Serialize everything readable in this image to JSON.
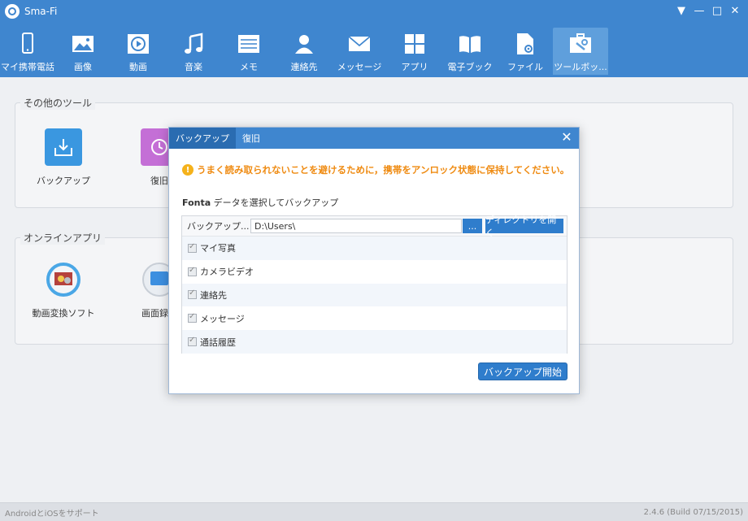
{
  "app": {
    "title": "Sma-Fi"
  },
  "window_controls": {
    "menu": "▼",
    "minimize": "—",
    "maximize": "□",
    "close": "✕"
  },
  "toolbar": {
    "items": [
      {
        "label": "マイ携帯電話",
        "icon": "phone-icon"
      },
      {
        "label": "画像",
        "icon": "image-icon"
      },
      {
        "label": "動画",
        "icon": "video-icon"
      },
      {
        "label": "音楽",
        "icon": "music-icon"
      },
      {
        "label": "メモ",
        "icon": "memo-icon"
      },
      {
        "label": "連絡先",
        "icon": "contacts-icon"
      },
      {
        "label": "メッセージ",
        "icon": "message-icon"
      },
      {
        "label": "アプリ",
        "icon": "apps-icon"
      },
      {
        "label": "電子ブック",
        "icon": "ebook-icon"
      },
      {
        "label": "ファイル",
        "icon": "file-icon"
      },
      {
        "label": "ツールボッ...",
        "icon": "toolbox-icon"
      }
    ],
    "active_index": 10
  },
  "groups": {
    "other_tools": {
      "title": "その他のツール",
      "tiles": [
        {
          "label": "バックアップ"
        },
        {
          "label": "復旧"
        }
      ]
    },
    "online_apps": {
      "title": "オンラインアプリ",
      "tiles": [
        {
          "label": "動画変換ソフト"
        },
        {
          "label": "画面録画"
        }
      ]
    }
  },
  "dialog": {
    "tabs": [
      {
        "label": "バックアップ"
      },
      {
        "label": "復旧"
      }
    ],
    "close": "✕",
    "warning": "うまく読み取られないことを避けるために，携帯をアンロック状態に保持してください。",
    "select_label_strong": "Fonta",
    "select_label_rest": " データを選択してバックアップ",
    "path_label": "バックアップ...",
    "path_value": "D:\\Users\\",
    "browse_label": "...",
    "open_dir_label": "ディレクトリを開く",
    "items": [
      {
        "label": "マイ写真",
        "checked": true
      },
      {
        "label": "カメラビデオ",
        "checked": true
      },
      {
        "label": "連絡先",
        "checked": true
      },
      {
        "label": "メッセージ",
        "checked": true
      },
      {
        "label": "通話履歴",
        "checked": true
      }
    ],
    "start_label": "バックアップ開始"
  },
  "status": {
    "left": "AndroidとiOSをサポート",
    "right": "2.4.6 (Build 07/15/2015)"
  },
  "colors": {
    "accent": "#3f86cf",
    "button": "#2f7dcc",
    "warning": "#ef8b12"
  }
}
